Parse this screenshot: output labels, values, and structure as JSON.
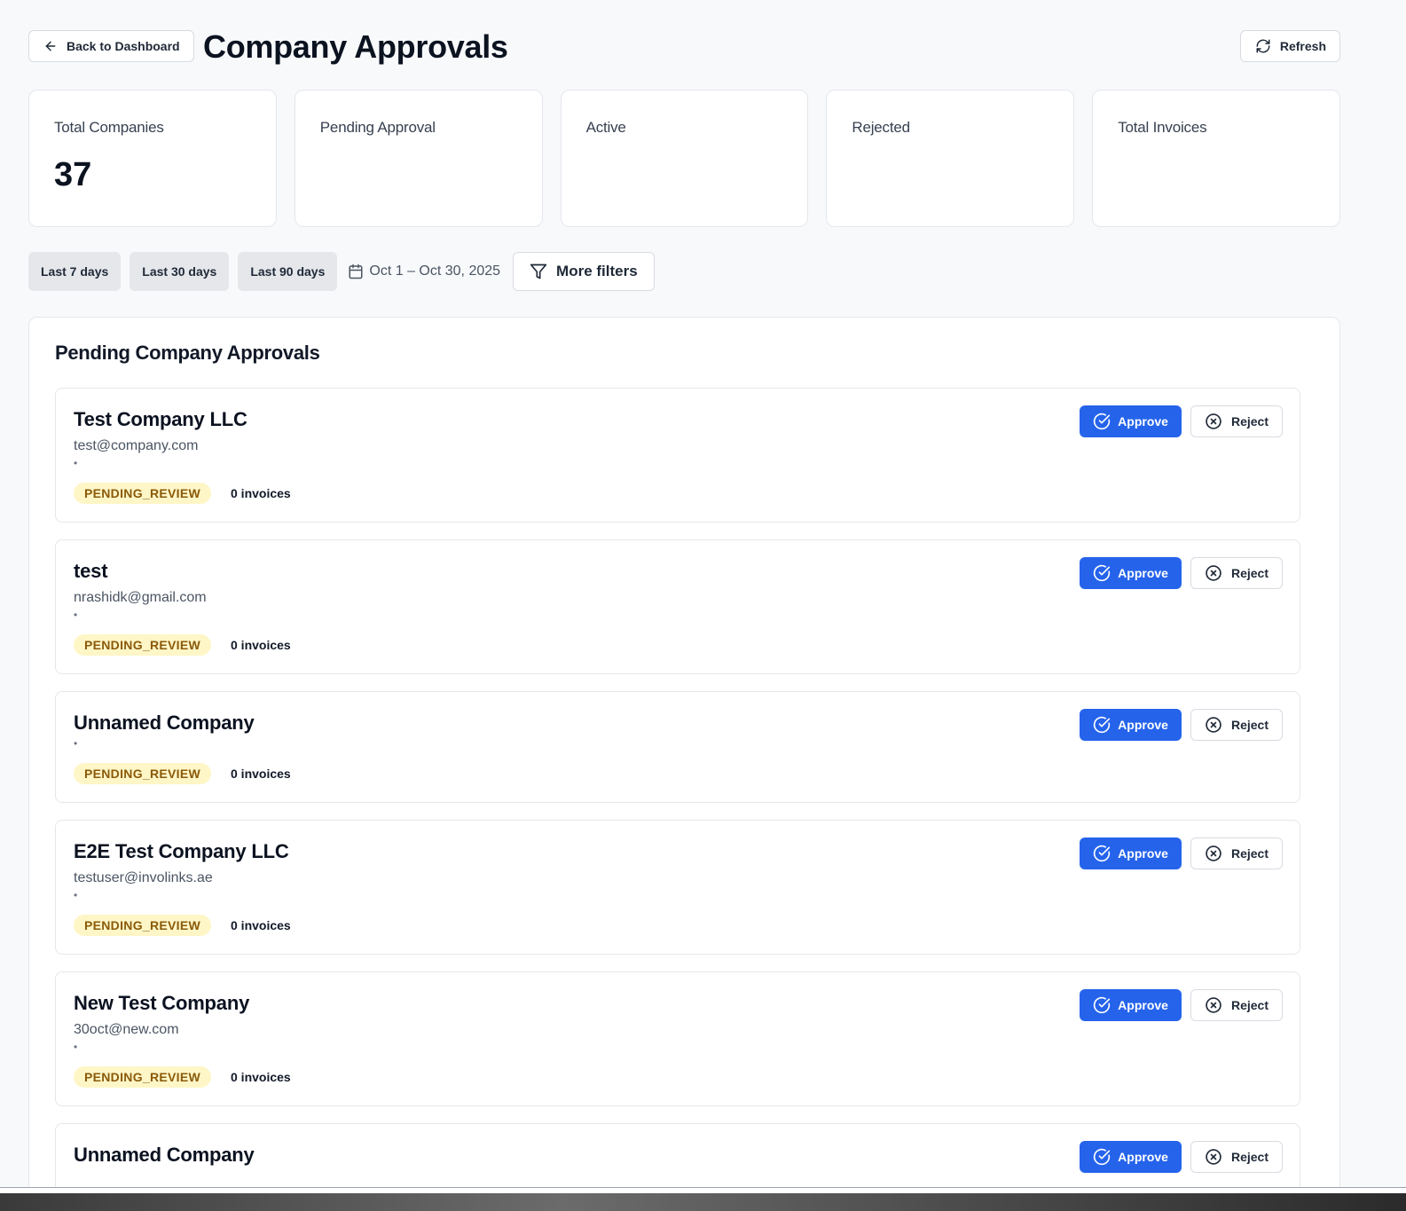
{
  "header": {
    "back_label": "Back to Dashboard",
    "title": "Company Approvals",
    "refresh_label": "Refresh"
  },
  "stats": [
    {
      "label": "Total Companies",
      "value": "37"
    },
    {
      "label": "Pending Approval",
      "value": ""
    },
    {
      "label": "Active",
      "value": ""
    },
    {
      "label": "Rejected",
      "value": ""
    },
    {
      "label": "Total Invoices",
      "value": ""
    }
  ],
  "filters": {
    "chips": [
      "Last 7 days",
      "Last 30 days",
      "Last 90 days"
    ],
    "date_range": "Oct 1 – Oct 30, 2025",
    "more_filters_label": "More filters"
  },
  "panel": {
    "title": "Pending Company Approvals"
  },
  "actions": {
    "approve_label": "Approve",
    "reject_label": "Reject"
  },
  "companies": [
    {
      "name": "Test Company LLC",
      "email": "test@company.com",
      "bullet": "•",
      "status": "PENDING_REVIEW",
      "invoices": "0 invoices"
    },
    {
      "name": "test",
      "email": "nrashidk@gmail.com",
      "bullet": "•",
      "status": "PENDING_REVIEW",
      "invoices": "0 invoices"
    },
    {
      "name": "Unnamed Company",
      "email": "",
      "bullet": "•",
      "status": "PENDING_REVIEW",
      "invoices": "0 invoices"
    },
    {
      "name": "E2E Test Company LLC",
      "email": "testuser@involinks.ae",
      "bullet": "•",
      "status": "PENDING_REVIEW",
      "invoices": "0 invoices"
    },
    {
      "name": "New Test Company",
      "email": "30oct@new.com",
      "bullet": "•",
      "status": "PENDING_REVIEW",
      "invoices": "0 invoices"
    },
    {
      "name": "Unnamed Company",
      "email": "",
      "bullet": "",
      "status": "",
      "invoices": ""
    }
  ],
  "colors": {
    "accent": "#2563eb",
    "badge_bg": "#fef6c7",
    "badge_text": "#8a5a0a",
    "page_bg": "#f8f9fb"
  },
  "icons": {
    "back": "arrow-left-icon",
    "refresh": "refresh-icon",
    "calendar": "calendar-icon",
    "filter": "filter-icon",
    "approve": "check-circle-icon",
    "reject": "x-circle-icon"
  }
}
